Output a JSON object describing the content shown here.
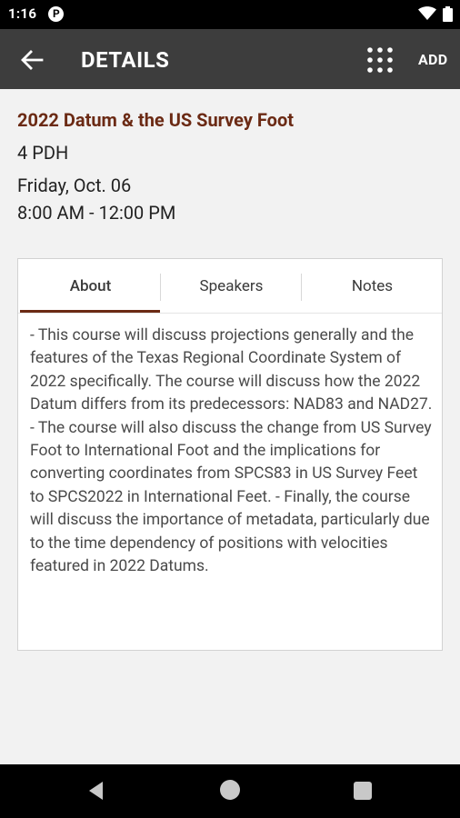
{
  "status_bar": {
    "time": "1:16",
    "notification_glyph": "P",
    "icons": [
      "notification-icon",
      "wifi-icon",
      "battery-icon"
    ]
  },
  "app_bar": {
    "title": "DETAILS",
    "add_label": "ADD",
    "icons": [
      "back-arrow-icon",
      "grid-icon"
    ],
    "background": "#3d3d3d"
  },
  "course": {
    "title": "2022 Datum & the US Survey Foot",
    "credits": "4 PDH",
    "date": "Friday, Oct. 06",
    "time": "8:00 AM - 12:00 PM",
    "title_color": "#6b2a14"
  },
  "tabs": [
    {
      "label": "About",
      "active": true
    },
    {
      "label": "Speakers",
      "active": false
    },
    {
      "label": "Notes",
      "active": false
    }
  ],
  "about_text": "- This course will discuss projections generally and the features of the Texas Regional Coordinate System of 2022 specifically. The course will discuss how the 2022 Datum differs from its predecessors: NAD83 and NAD27. - The course will also discuss the change from US Survey Foot to International Foot and the implications for converting coordinates from SPCS83 in US Survey Feet to SPCS2022 in International Feet. - Finally, the course will discuss the importance of metadata, particularly due to the time dependency of positions with velocities featured in 2022 Datums.",
  "nav_bar": {
    "icons": [
      "nav-back-icon",
      "nav-home-icon",
      "nav-recents-icon"
    ]
  }
}
